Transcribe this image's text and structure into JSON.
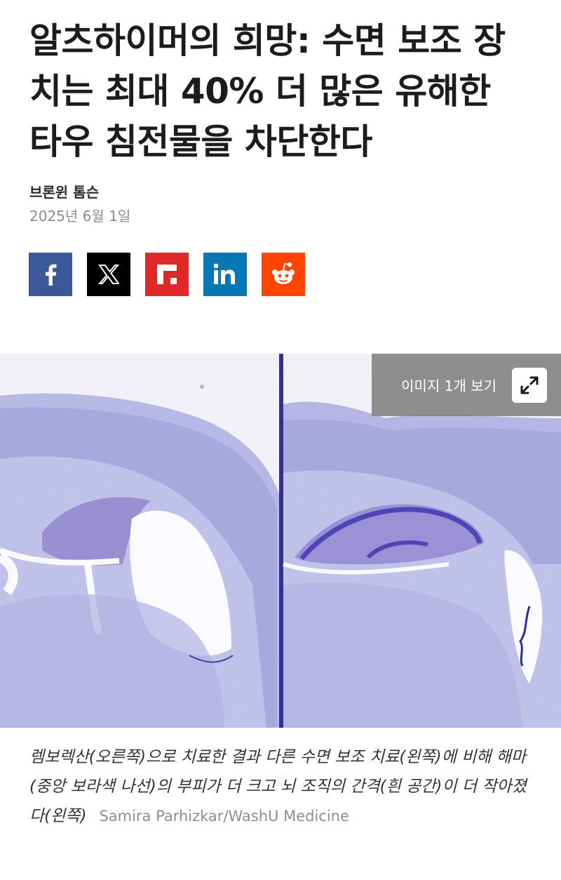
{
  "article": {
    "headline": "알츠하이머의 희망: 수면 보조 장치는 최대 40% 더 많은 유해한 타우 침전물을 차단한다",
    "author": "브론윈 톰슨",
    "date": "2025년 6월 1일"
  },
  "share": [
    {
      "name": "facebook",
      "icon": "facebook-icon",
      "color": "#3b5998"
    },
    {
      "name": "x",
      "icon": "x-icon",
      "color": "#000000"
    },
    {
      "name": "flipboard",
      "icon": "flipboard-icon",
      "color": "#e12828"
    },
    {
      "name": "linkedin",
      "icon": "linkedin-icon",
      "color": "#0a77b5"
    },
    {
      "name": "reddit",
      "icon": "reddit-icon",
      "color": "#ff4500"
    }
  ],
  "figure": {
    "view_label": "이미지 1개 보기",
    "expand_icon": "expand-icon",
    "caption": "렘보렉산(오른쪽)으로 치료한 결과 다른 수면 보조 치료(왼쪽)에 비해 해마(중앙 보라색 나선)의 부피가 더 크고 뇌 조직의 간격(흰 공간)이 더 작아졌다(왼쪽)",
    "credit": "Samira Parhizkar/WashU Medicine"
  }
}
